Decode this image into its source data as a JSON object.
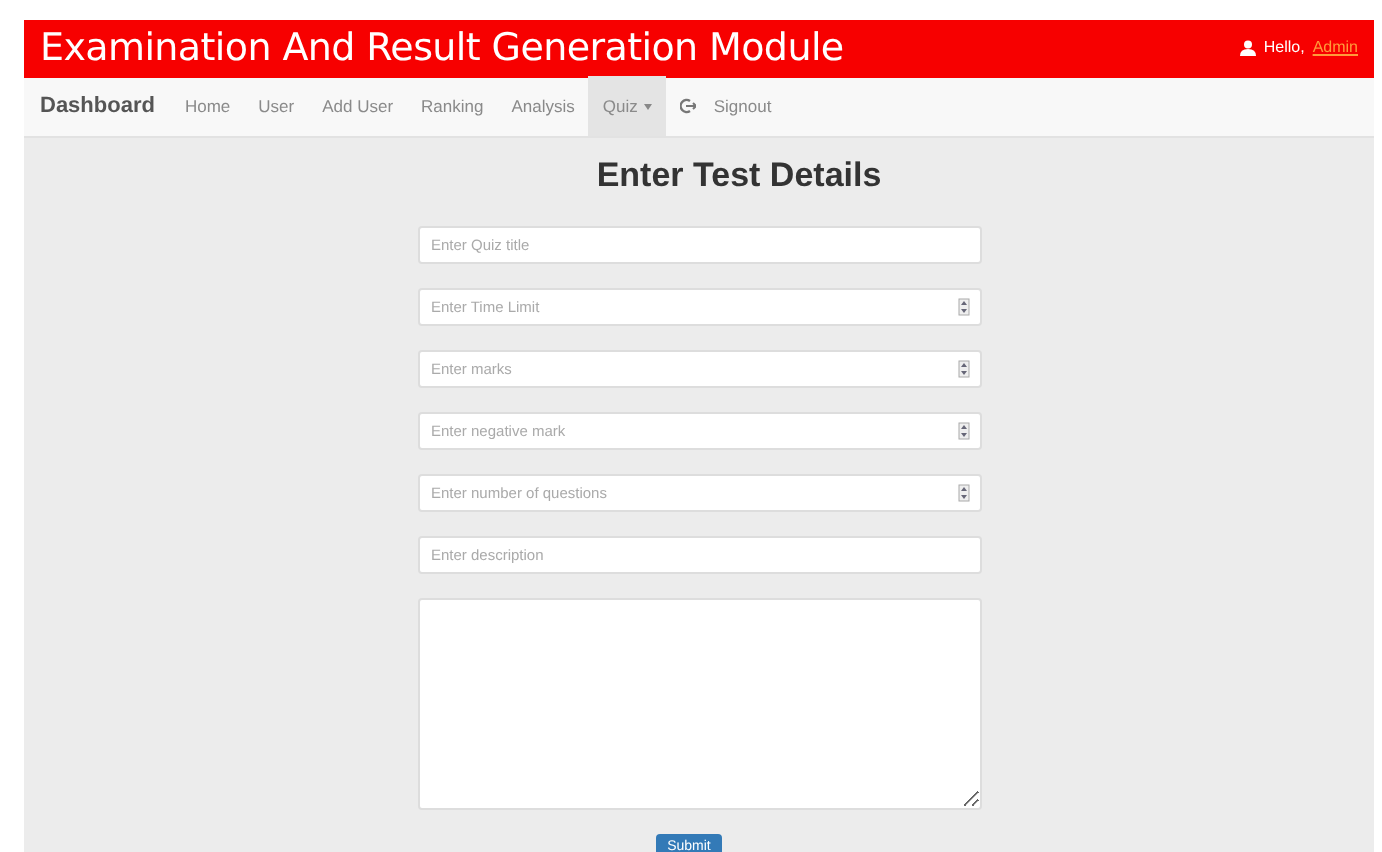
{
  "header": {
    "title": "Examination And Result Generation Module",
    "greeting": "Hello,",
    "user": "Admin"
  },
  "navbar": {
    "brand": "Dashboard",
    "items": [
      {
        "label": "Home",
        "selected": false,
        "kind": "link"
      },
      {
        "label": "User",
        "selected": false,
        "kind": "link"
      },
      {
        "label": "Add User",
        "selected": false,
        "kind": "link"
      },
      {
        "label": "Ranking",
        "selected": false,
        "kind": "link"
      },
      {
        "label": "Analysis",
        "selected": false,
        "kind": "link"
      },
      {
        "label": "Quiz",
        "selected": true,
        "kind": "dropdown"
      },
      {
        "label": "Signout",
        "selected": false,
        "kind": "signout"
      }
    ]
  },
  "form": {
    "title": "Enter Test Details",
    "fields": [
      {
        "placeholder": "Enter Quiz title",
        "kind": "text"
      },
      {
        "placeholder": "Enter Time Limit",
        "kind": "number"
      },
      {
        "placeholder": "Enter marks",
        "kind": "number"
      },
      {
        "placeholder": "Enter negative mark",
        "kind": "number"
      },
      {
        "placeholder": "Enter number of questions",
        "kind": "number"
      },
      {
        "placeholder": "Enter description",
        "kind": "text"
      },
      {
        "kind": "textarea"
      }
    ],
    "submit": "Submit"
  }
}
